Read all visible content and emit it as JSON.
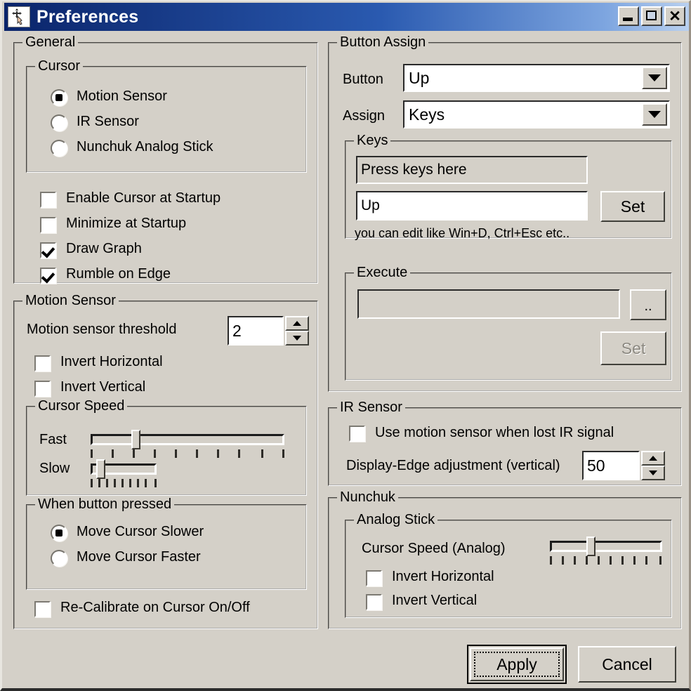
{
  "window": {
    "title": "Preferences",
    "icon": "cursor-move-icon",
    "controls": {
      "minimize": "minimize-button",
      "restore": "restore-button",
      "close": "close-button"
    }
  },
  "general": {
    "label": "General",
    "cursor": {
      "label": "Cursor",
      "options": [
        {
          "label": "Motion Sensor",
          "selected": true
        },
        {
          "label": "IR Sensor",
          "selected": false
        },
        {
          "label": "Nunchuk Analog Stick",
          "selected": false
        }
      ]
    },
    "checkboxes": [
      {
        "label": "Enable Cursor at Startup",
        "checked": false
      },
      {
        "label": "Minimize at Startup",
        "checked": false
      },
      {
        "label": "Draw Graph",
        "checked": true
      },
      {
        "label": "Rumble on Edge",
        "checked": true
      }
    ]
  },
  "motion_sensor": {
    "label": "Motion Sensor",
    "threshold_label": "Motion sensor threshold",
    "threshold_value": "2",
    "checkboxes": [
      {
        "label": "Invert Horizontal",
        "checked": false
      },
      {
        "label": "Invert Vertical",
        "checked": false
      }
    ],
    "cursor_speed": {
      "label": "Cursor Speed",
      "fast_label": "Fast",
      "slow_label": "Slow",
      "fast_value": 2,
      "fast_ticks": 10,
      "slow_value": 1,
      "slow_ticks": 9
    },
    "when_button_pressed": {
      "label": "When button pressed",
      "options": [
        {
          "label": "Move Cursor Slower",
          "selected": true
        },
        {
          "label": "Move Cursor Faster",
          "selected": false
        }
      ]
    },
    "recalibrate": {
      "label": "Re-Calibrate on Cursor On/Off",
      "checked": false
    }
  },
  "button_assign": {
    "label": "Button Assign",
    "button_label": "Button",
    "button_value": "Up",
    "assign_label": "Assign",
    "assign_value": "Keys",
    "keys": {
      "label": "Keys",
      "press_field_value": "Press keys here",
      "edit_field_value": "Up",
      "set_label": "Set",
      "hint": "you can edit like Win+D, Ctrl+Esc etc.."
    },
    "execute": {
      "label": "Execute",
      "path_value": "",
      "browse_label": "..",
      "set_label": "Set",
      "set_disabled": true
    }
  },
  "ir_sensor": {
    "label": "IR Sensor",
    "use_motion": {
      "label": "Use motion sensor when lost IR signal",
      "checked": false
    },
    "display_edge_label": "Display-Edge adjustment (vertical)",
    "display_edge_value": "50"
  },
  "nunchuk": {
    "label": "Nunchuk",
    "analog_stick": {
      "label": "Analog Stick",
      "speed_label": "Cursor Speed (Analog)",
      "speed_value": 3,
      "speed_ticks": 10,
      "checkboxes": [
        {
          "label": "Invert Horizontal",
          "checked": false
        },
        {
          "label": "Invert Vertical",
          "checked": false
        }
      ]
    }
  },
  "footer": {
    "apply_label": "Apply",
    "cancel_label": "Cancel"
  },
  "colors": {
    "face": "#d4d0c8",
    "title_start": "#0a246a",
    "title_end": "#b9d0ef",
    "text": "#000000",
    "disabled_text": "#8b8880"
  }
}
